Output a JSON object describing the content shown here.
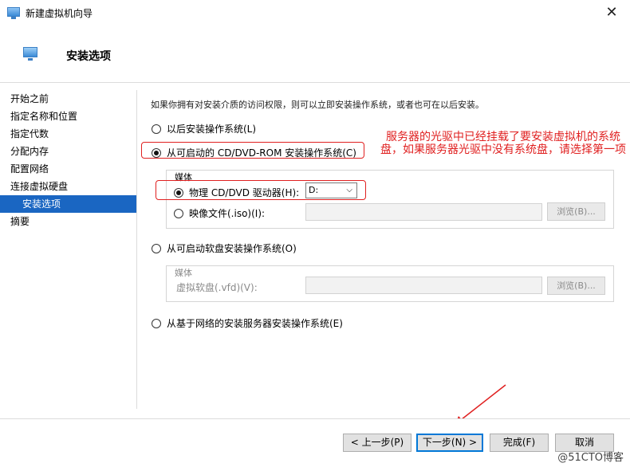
{
  "window": {
    "title": "新建虚拟机向导",
    "close": "✕"
  },
  "header": {
    "title": "安装选项"
  },
  "sidebar": {
    "items": [
      {
        "label": "开始之前"
      },
      {
        "label": "指定名称和位置"
      },
      {
        "label": "指定代数"
      },
      {
        "label": "分配内存"
      },
      {
        "label": "配置网络"
      },
      {
        "label": "连接虚拟硬盘"
      },
      {
        "label": "安装选项"
      },
      {
        "label": "摘要"
      }
    ]
  },
  "main": {
    "intro": "如果你拥有对安装介质的访问权限，则可以立即安装操作系统，或者也可在以后安装。",
    "opt_later": "以后安装操作系统(L)",
    "opt_cd": "从可启动的 CD/DVD-ROM 安装操作系统(C)",
    "media_label": "媒体",
    "physical": "物理 CD/DVD 驱动器(H):",
    "drive": "D:",
    "image_file": "映像文件(.iso)(I):",
    "browse1": "浏览(B)...",
    "opt_floppy": "从可启动软盘安装操作系统(O)",
    "media_label2": "媒体",
    "vfd": "虚拟软盘(.vfd)(V):",
    "browse2": "浏览(B)...",
    "opt_network": "从基于网络的安装服务器安装操作系统(E)"
  },
  "annotation": "服务器的光驱中已经挂载了要安装虚拟机的系统盘，如果服务器光驱中没有系统盘，请选择第一项",
  "footer": {
    "prev": "< 上一步(P)",
    "next": "下一步(N) >",
    "finish": "完成(F)",
    "cancel": "取消",
    "watermark": "@51CTO博客"
  }
}
